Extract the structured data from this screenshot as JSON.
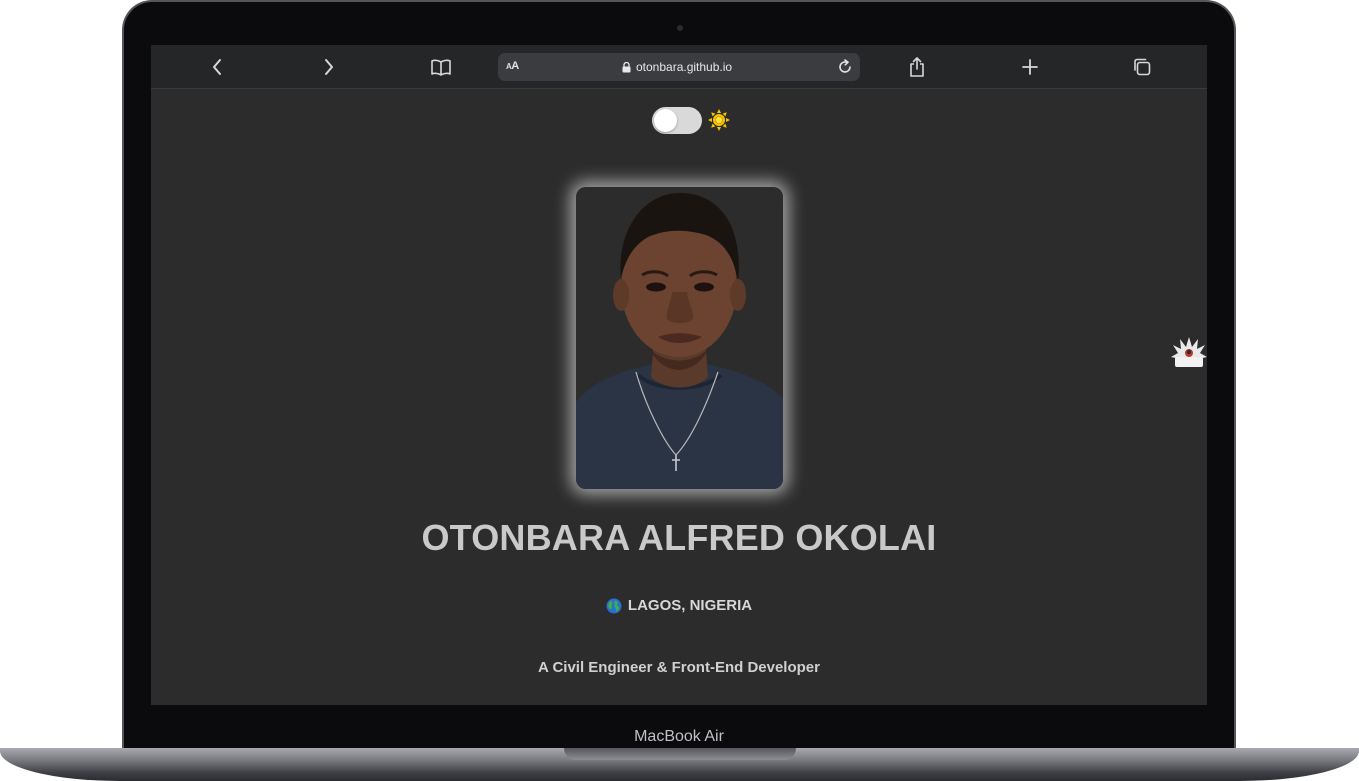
{
  "device": {
    "label": "MacBook Air"
  },
  "browser": {
    "text_size_label": "AA",
    "url": "otonbara.github.io",
    "icons": {
      "back": "chevron-left-icon",
      "forward": "chevron-right-icon",
      "bookmarks": "book-icon",
      "lock": "lock-icon",
      "reload": "reload-icon",
      "share": "share-icon",
      "new_tab": "plus-icon",
      "tabs": "tabs-icon"
    }
  },
  "page": {
    "theme_toggle": {
      "state": "off",
      "icon": "sun-icon",
      "icon_color": "#f5c400"
    },
    "profile_photo": {
      "icon": "profile-photo"
    },
    "name": "OTONBARA ALFRED OKOLAI",
    "location": {
      "icon": "globe-icon",
      "text": "LAGOS, NIGERIA"
    },
    "tagline": "A Civil Engineer & Front-End Developer",
    "side_logo": {
      "icon": "spiky-logo-icon"
    }
  },
  "colors": {
    "page_background": "#2c2c2c",
    "toolbar_background": "#252628",
    "name_text": "#c9c9c9"
  }
}
